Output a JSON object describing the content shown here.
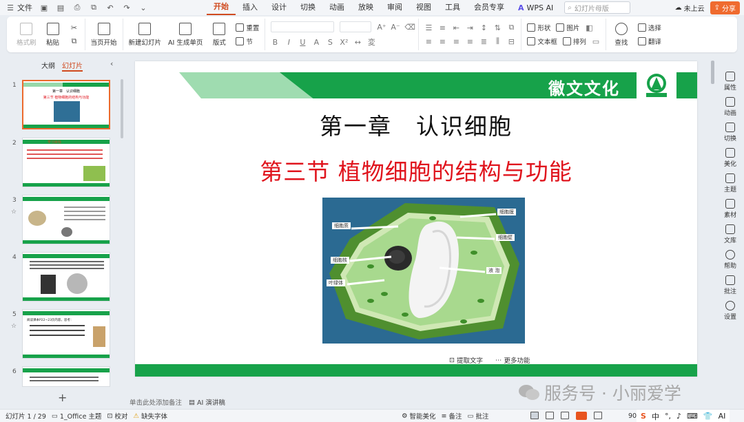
{
  "menubar": {
    "file_label": "文件",
    "menus": [
      "开始",
      "插入",
      "设计",
      "切换",
      "动画",
      "放映",
      "审阅",
      "视图",
      "工具",
      "会员专享"
    ],
    "active_menu": "开始",
    "wps_ai": "WPS AI",
    "search_placeholder": "幻灯片母版",
    "cloud_label": "未上云",
    "share_label": "分享"
  },
  "ribbon": {
    "format_painter": "格式刷",
    "paste": "粘贴",
    "start_from_current": "当页开始",
    "new_slide": "新建幻灯片",
    "ai_slide": "AI 生成单页",
    "layout": "版式",
    "reset": "重置",
    "section": "节",
    "shape": "形状",
    "picture": "图片",
    "textbox": "文本框",
    "arrange": "排列",
    "find": "查找",
    "select": "选择",
    "translate": "翻译"
  },
  "left_panel": {
    "tab_outline": "大纲",
    "tab_slides": "幻灯片",
    "slide_numbers": [
      "1",
      "2",
      "3",
      "4",
      "5",
      "6"
    ]
  },
  "slide": {
    "brand": "徽文文化",
    "logo_text": "徽文文化",
    "title": "第一章　认识细胞",
    "subtitle": "第三节  植物细胞的结构与功能",
    "photo_labels": {
      "cytoplasm": "细胞质",
      "cell_membrane": "细胞膜",
      "cell_wall": "细胞壁",
      "nucleus": "细胞核",
      "vacuole": "液 泡",
      "chloroplast": "叶绿体"
    },
    "tool_extract": "提取文字",
    "tool_more": "更多功能"
  },
  "thumbs": {
    "t1_title": "第一章　认识细胞",
    "t1_sub": "第三节  植物细胞的结构与功能",
    "t2_title": "学习目标",
    "t5_title": "阅读课本P22~23页内容，思考："
  },
  "right_toolbar": [
    "属性",
    "动画",
    "切换",
    "美化",
    "主题",
    "素材",
    "文库",
    "帮助",
    "批注",
    "设置"
  ],
  "notes": {
    "placeholder": "单击此处添加备注",
    "ai_speech": "AI 演讲稿"
  },
  "watermark": "服务号 · 小丽爱学",
  "statusbar": {
    "slide_counter": "幻灯片 1 / 29",
    "theme": "1_Office 主题",
    "proofread": "校对",
    "missing_font": "缺失字体",
    "smart_beautify": "智能美化",
    "notes": "备注",
    "comments": "批注",
    "zoom": "90",
    "ime_lang": "中"
  },
  "colors": {
    "brand_green": "#17a24a",
    "light_green": "#9fdcb0",
    "accent_orange": "#d04a1e",
    "subtitle_red": "#e0141d"
  }
}
